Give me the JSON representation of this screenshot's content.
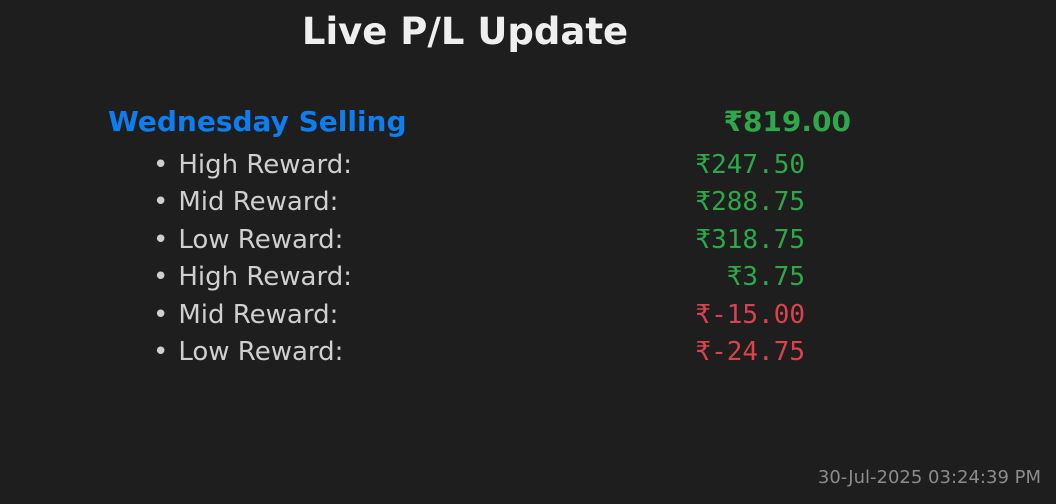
{
  "title": "Live P/L Update",
  "section": {
    "label": "Wednesday Selling",
    "total": "₹819.00",
    "label_color": "#0d7ef0",
    "total_color": "#2ea84a"
  },
  "rows": [
    {
      "bullet": "•",
      "label": "High Reward:",
      "value": "₹247.50",
      "status": "positive"
    },
    {
      "bullet": "•",
      "label": "Mid Reward:",
      "value": "₹288.75",
      "status": "positive"
    },
    {
      "bullet": "•",
      "label": "Low Reward:",
      "value": "₹318.75",
      "status": "positive"
    },
    {
      "bullet": "•",
      "label": "High Reward:",
      "value": "₹3.75",
      "status": "positive"
    },
    {
      "bullet": "•",
      "label": "Mid Reward:",
      "value": "₹-15.00",
      "status": "negative"
    },
    {
      "bullet": "•",
      "label": "Low Reward:",
      "value": "₹-24.75",
      "status": "negative"
    }
  ],
  "colors": {
    "positive": "#2ea84a",
    "negative": "#d9434f"
  },
  "timestamp": "30-Jul-2025 03:24:39 PM"
}
